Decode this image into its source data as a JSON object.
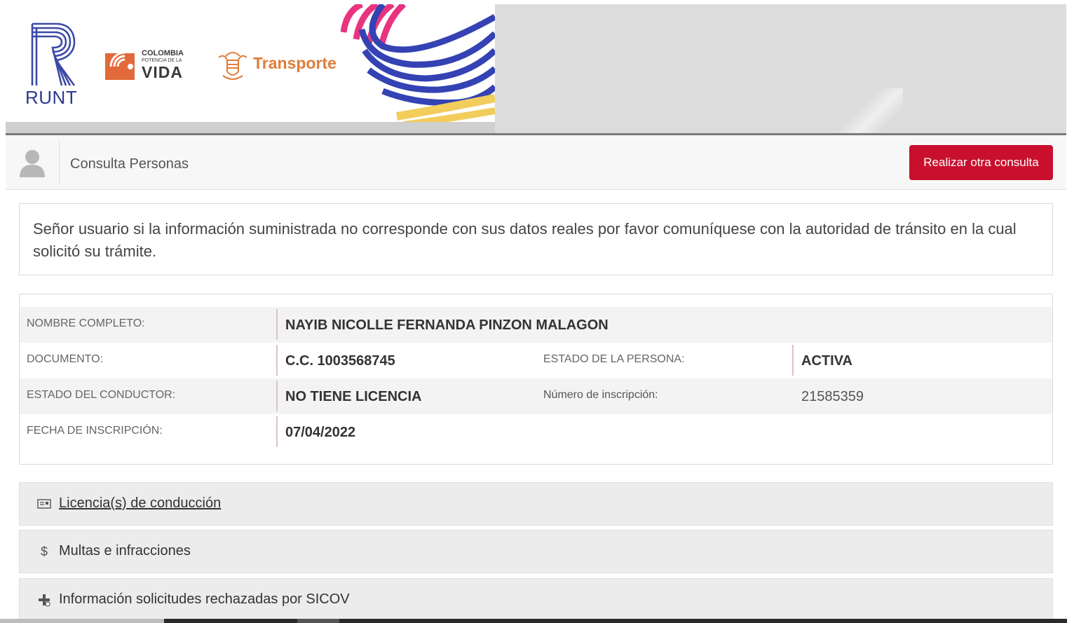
{
  "banner": {
    "runt_logo_text": "RUNT",
    "colombia_line1": "COLOMBIA",
    "colombia_line2": "POTENCIA DE LA",
    "colombia_line3": "VIDA",
    "transporte_text": "Transporte"
  },
  "header": {
    "icon": "user-silhouette-icon",
    "title": "Consulta Personas",
    "action_button": "Realizar otra consulta",
    "accent_color": "#c8102e"
  },
  "notice": {
    "text": "Señor usuario si la información suministrada no corresponde con sus datos reales por favor comuníquese con la autoridad de tránsito en la cual solicitó su trámite."
  },
  "person": {
    "nombre_label": "NOMBRE COMPLETO:",
    "nombre_value": "NAYIB NICOLLE FERNANDA PINZON MALAGON",
    "documento_label": "DOCUMENTO:",
    "documento_value": "C.C. 1003568745",
    "estado_persona_label": "ESTADO DE LA PERSONA:",
    "estado_persona_value": "ACTIVA",
    "estado_conductor_label": "ESTADO DEL CONDUCTOR:",
    "estado_conductor_value": "NO TIENE LICENCIA",
    "numero_inscripcion_label": "Número de inscripción:",
    "numero_inscripcion_value": "21585359",
    "fecha_inscripcion_label": "FECHA DE INSCRIPCIÓN:",
    "fecha_inscripcion_value": "07/04/2022"
  },
  "sections": [
    {
      "icon": "id-card-icon",
      "label": "Licencia(s) de conducción"
    },
    {
      "icon": "dollar-icon",
      "label": "Multas e infracciones"
    },
    {
      "icon": "medical-cross-icon",
      "label": "Información solicitudes rechazadas por SICOV"
    }
  ]
}
